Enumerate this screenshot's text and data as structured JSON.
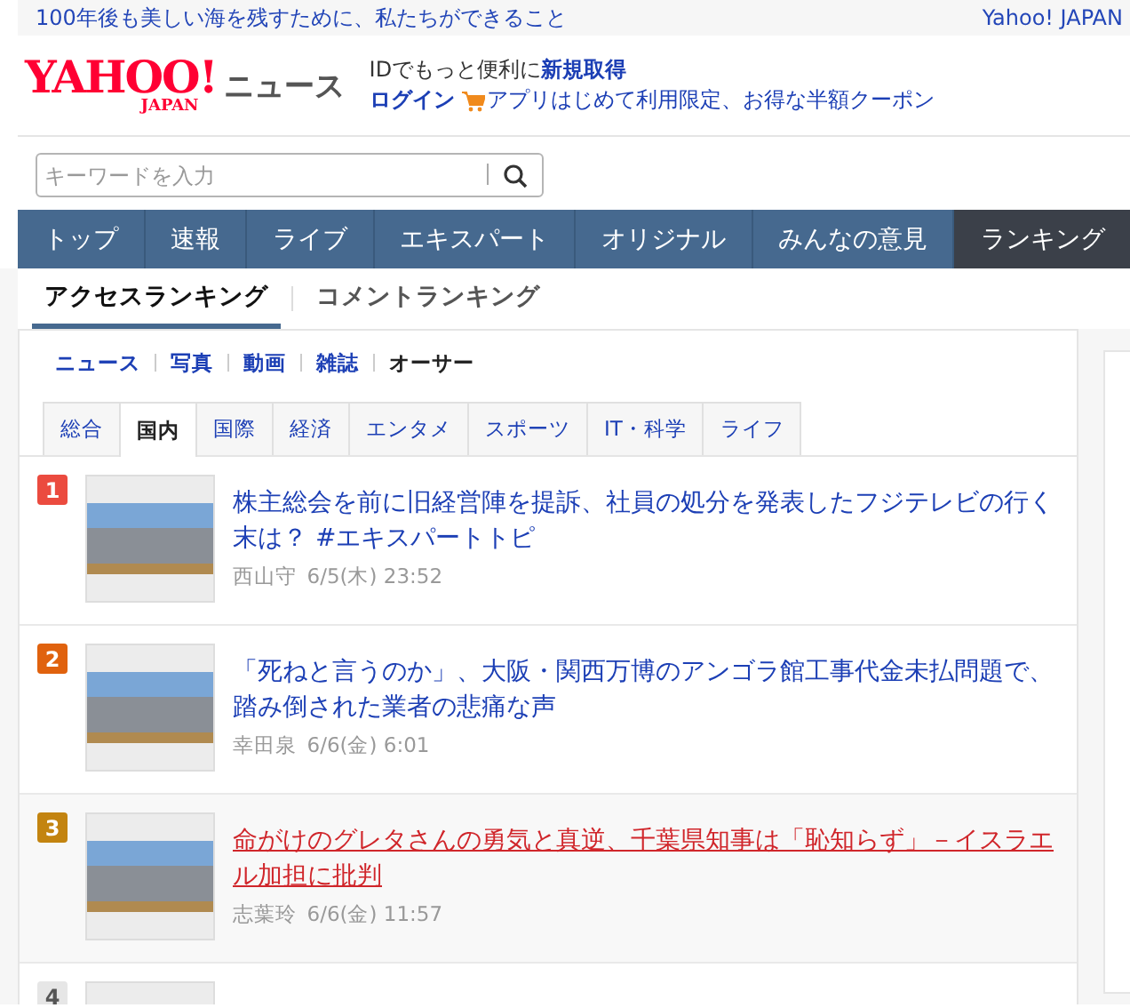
{
  "banner": {
    "message": "100年後も美しい海を残すために、私たちができること",
    "portal_link": "Yahoo! JAPAN"
  },
  "header": {
    "logo": {
      "wordmark": "YAHOO!",
      "region": "JAPAN",
      "service": "ニュース"
    },
    "promo_text": "IDでもっと便利に",
    "signup_link": "新規取得",
    "login_link": "ログイン",
    "coupon_link": "アプリはじめて利用限定、お得な半額クーポン"
  },
  "search": {
    "placeholder": "キーワードを入力"
  },
  "nav": [
    {
      "label": "トップ",
      "selected": false
    },
    {
      "label": "速報",
      "selected": false
    },
    {
      "label": "ライブ",
      "selected": false
    },
    {
      "label": "エキスパート",
      "selected": false
    },
    {
      "label": "オリジナル",
      "selected": false
    },
    {
      "label": "みんなの意見",
      "selected": false
    },
    {
      "label": "ランキング",
      "selected": true
    }
  ],
  "ranking_tabs": [
    {
      "label": "アクセスランキング",
      "selected": true
    },
    {
      "label": "コメントランキング",
      "selected": false
    }
  ],
  "media_links": [
    {
      "label": "ニュース",
      "selected": false
    },
    {
      "label": "写真",
      "selected": false
    },
    {
      "label": "動画",
      "selected": false
    },
    {
      "label": "雑誌",
      "selected": false
    },
    {
      "label": "オーサー",
      "selected": true
    }
  ],
  "category_tabs": [
    {
      "label": "総合",
      "selected": false
    },
    {
      "label": "国内",
      "selected": true
    },
    {
      "label": "国際",
      "selected": false
    },
    {
      "label": "経済",
      "selected": false
    },
    {
      "label": "エンタメ",
      "selected": false
    },
    {
      "label": "スポーツ",
      "selected": false
    },
    {
      "label": "IT・科学",
      "selected": false
    },
    {
      "label": "ライフ",
      "selected": false
    }
  ],
  "articles": [
    {
      "rank": "1",
      "color": "#eb4b3f",
      "title": "株主総会を前に旧経営陣を提訴、社員の処分を発表したフジテレビの行く末は？ #エキスパートトピ",
      "author": "西山守",
      "date": "6/5(木) 23:52",
      "hovered": false
    },
    {
      "rank": "2",
      "color": "#e0620e",
      "title": "「死ねと言うのか」、大阪・関西万博のアンゴラ館工事代金未払問題で、踏み倒された業者の悲痛な声",
      "author": "幸田泉",
      "date": "6/6(金) 6:01",
      "hovered": false
    },
    {
      "rank": "3",
      "color": "#c38410",
      "title": "命がけのグレタさんの勇気と真逆、千葉県知事は「恥知らず」－イスラエル加担に批判",
      "author": "志葉玲",
      "date": "6/6(金) 11:57",
      "hovered": true
    },
    {
      "rank": "4",
      "color": "#e6e6e6"
    }
  ]
}
